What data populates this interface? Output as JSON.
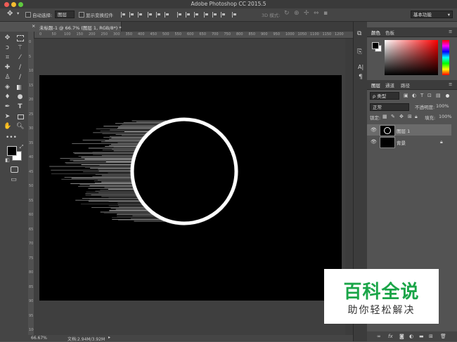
{
  "app_title": "Adobe Photoshop CC 2015.5",
  "options_bar": {
    "auto_select_label": "自动选择:",
    "auto_select_value": "图层",
    "show_transform_label": "显示变换控件",
    "mode_3d": "3D 模式:",
    "workspace": "基本功能"
  },
  "document_tab": {
    "title": "未标题-1 @ 66.7% (图层 1, RGB/8*) *",
    "close": "×"
  },
  "ruler_top_ticks": [
    "0",
    "50",
    "100",
    "150",
    "200",
    "250",
    "300",
    "350",
    "400",
    "450",
    "500",
    "550",
    "600",
    "650",
    "700",
    "750",
    "800",
    "850",
    "900",
    "950",
    "1000",
    "1050",
    "1100",
    "1150",
    "1200"
  ],
  "ruler_left_ticks": [
    "0",
    "5",
    "10",
    "15",
    "20",
    "25",
    "30",
    "35",
    "40",
    "45",
    "50",
    "55",
    "60",
    "65",
    "70",
    "75",
    "80",
    "85",
    "90",
    "95",
    "100"
  ],
  "status": {
    "zoom": "66.67%",
    "doc_info": "文档:2.94M/3.92M"
  },
  "color_panel": {
    "tabs": [
      "颜色",
      "色板"
    ],
    "foreground": "#000000",
    "background": "#ffffff",
    "picker_hue": "#ff0000"
  },
  "layers_panel": {
    "tabs": [
      "图层",
      "通道",
      "路径"
    ],
    "filter_label": "ρ 类型",
    "blend_mode": "正常",
    "opacity_label": "不透明度:",
    "opacity_value": "100%",
    "lock_label": "锁定:",
    "fill_label": "填充:",
    "fill_value": "100%",
    "layers": [
      {
        "name": "图层 1",
        "selected": true
      },
      {
        "name": "背景",
        "selected": false
      }
    ]
  },
  "tools": [
    "move",
    "marquee",
    "lasso",
    "magic-wand",
    "crop",
    "eyedropper",
    "healing",
    "brush",
    "stamp",
    "history-brush",
    "eraser",
    "gradient",
    "blur",
    "dodge",
    "pen",
    "type",
    "path-select",
    "rectangle",
    "hand",
    "zoom"
  ],
  "watermark": {
    "title": "百科全说",
    "subtitle": "助你轻松解决"
  }
}
